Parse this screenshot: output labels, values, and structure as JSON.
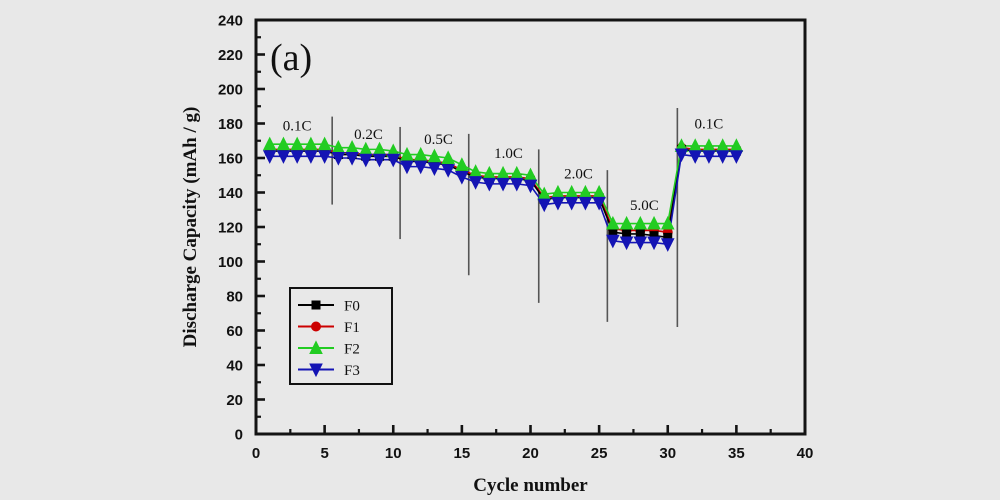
{
  "chart_data": {
    "type": "line",
    "title": "",
    "panel_label": "(a)",
    "xlabel": "Cycle number",
    "ylabel": "Discharge Capacity (mAh / g)",
    "xlim": [
      0,
      40
    ],
    "ylim": [
      0,
      240
    ],
    "xticks": [
      0,
      5,
      10,
      15,
      20,
      25,
      30,
      35,
      40
    ],
    "yticks": [
      0,
      20,
      40,
      60,
      80,
      100,
      120,
      140,
      160,
      180,
      200,
      220,
      240
    ],
    "x_minor_step": 2.5,
    "y_minor_step": 10,
    "grid": false,
    "legend_position": "lower-left-inside",
    "x": [
      1,
      2,
      3,
      4,
      5,
      6,
      7,
      8,
      9,
      10,
      11,
      12,
      13,
      14,
      15,
      16,
      17,
      18,
      19,
      20,
      21,
      22,
      23,
      24,
      25,
      26,
      27,
      28,
      29,
      30,
      31,
      32,
      33,
      34,
      35
    ],
    "series": [
      {
        "name": "F0",
        "color": "#000000",
        "marker": "square",
        "values": [
          164,
          164,
          164,
          164,
          164,
          162,
          162,
          161,
          161,
          161,
          158,
          158,
          157,
          156,
          152,
          149,
          148,
          148,
          148,
          147,
          136,
          137,
          137,
          137,
          137,
          117,
          116,
          116,
          115,
          114,
          165,
          164,
          164,
          164,
          164
        ]
      },
      {
        "name": "F1",
        "color": "#cc0000",
        "marker": "circle",
        "values": [
          165,
          165,
          165,
          165,
          165,
          163,
          163,
          162,
          162,
          162,
          159,
          159,
          158,
          157,
          153,
          150,
          149,
          149,
          149,
          148,
          137,
          138,
          138,
          138,
          138,
          119,
          118,
          118,
          118,
          117,
          166,
          165,
          165,
          165,
          165
        ]
      },
      {
        "name": "F2",
        "color": "#22cc22",
        "marker": "triangle-up",
        "values": [
          168,
          168,
          168,
          168,
          168,
          166,
          166,
          165,
          165,
          164,
          162,
          162,
          161,
          160,
          156,
          152,
          151,
          151,
          151,
          150,
          139,
          140,
          140,
          140,
          140,
          122,
          122,
          122,
          122,
          122,
          167,
          167,
          167,
          167,
          167
        ]
      },
      {
        "name": "F3",
        "color": "#1414b4",
        "marker": "triangle-down",
        "values": [
          161,
          161,
          161,
          161,
          161,
          160,
          160,
          159,
          159,
          159,
          155,
          155,
          154,
          153,
          149,
          146,
          145,
          145,
          145,
          144,
          133,
          134,
          134,
          134,
          134,
          112,
          111,
          111,
          111,
          110,
          162,
          161,
          161,
          161,
          161
        ]
      }
    ],
    "rate_annotations": [
      {
        "label": "0.1C",
        "x": 3.0,
        "y": 176
      },
      {
        "label": "0.2C",
        "x": 8.2,
        "y": 171
      },
      {
        "label": "0.5C",
        "x": 13.3,
        "y": 168
      },
      {
        "label": "1.0C",
        "x": 18.4,
        "y": 160
      },
      {
        "label": "2.0C",
        "x": 23.5,
        "y": 148
      },
      {
        "label": "5.0C",
        "x": 28.3,
        "y": 130
      },
      {
        "label": "0.1C",
        "x": 33.0,
        "y": 177
      }
    ],
    "separators": [
      {
        "x": 5.55,
        "y_top": 184,
        "y_bottom": 133
      },
      {
        "x": 10.5,
        "y_top": 178,
        "y_bottom": 113
      },
      {
        "x": 15.5,
        "y_top": 174,
        "y_bottom": 92
      },
      {
        "x": 20.6,
        "y_top": 165,
        "y_bottom": 76
      },
      {
        "x": 25.6,
        "y_top": 153,
        "y_bottom": 65
      },
      {
        "x": 30.7,
        "y_top": 189,
        "y_bottom": 62
      }
    ],
    "legend": [
      {
        "label": "F0",
        "color": "#000000",
        "marker": "square"
      },
      {
        "label": "F1",
        "color": "#cc0000",
        "marker": "circle"
      },
      {
        "label": "F2",
        "color": "#22cc22",
        "marker": "triangle-up"
      },
      {
        "label": "F3",
        "color": "#1414b4",
        "marker": "triangle-down"
      }
    ],
    "background_color": "#e8e8e8",
    "axis_color": "#141414"
  }
}
